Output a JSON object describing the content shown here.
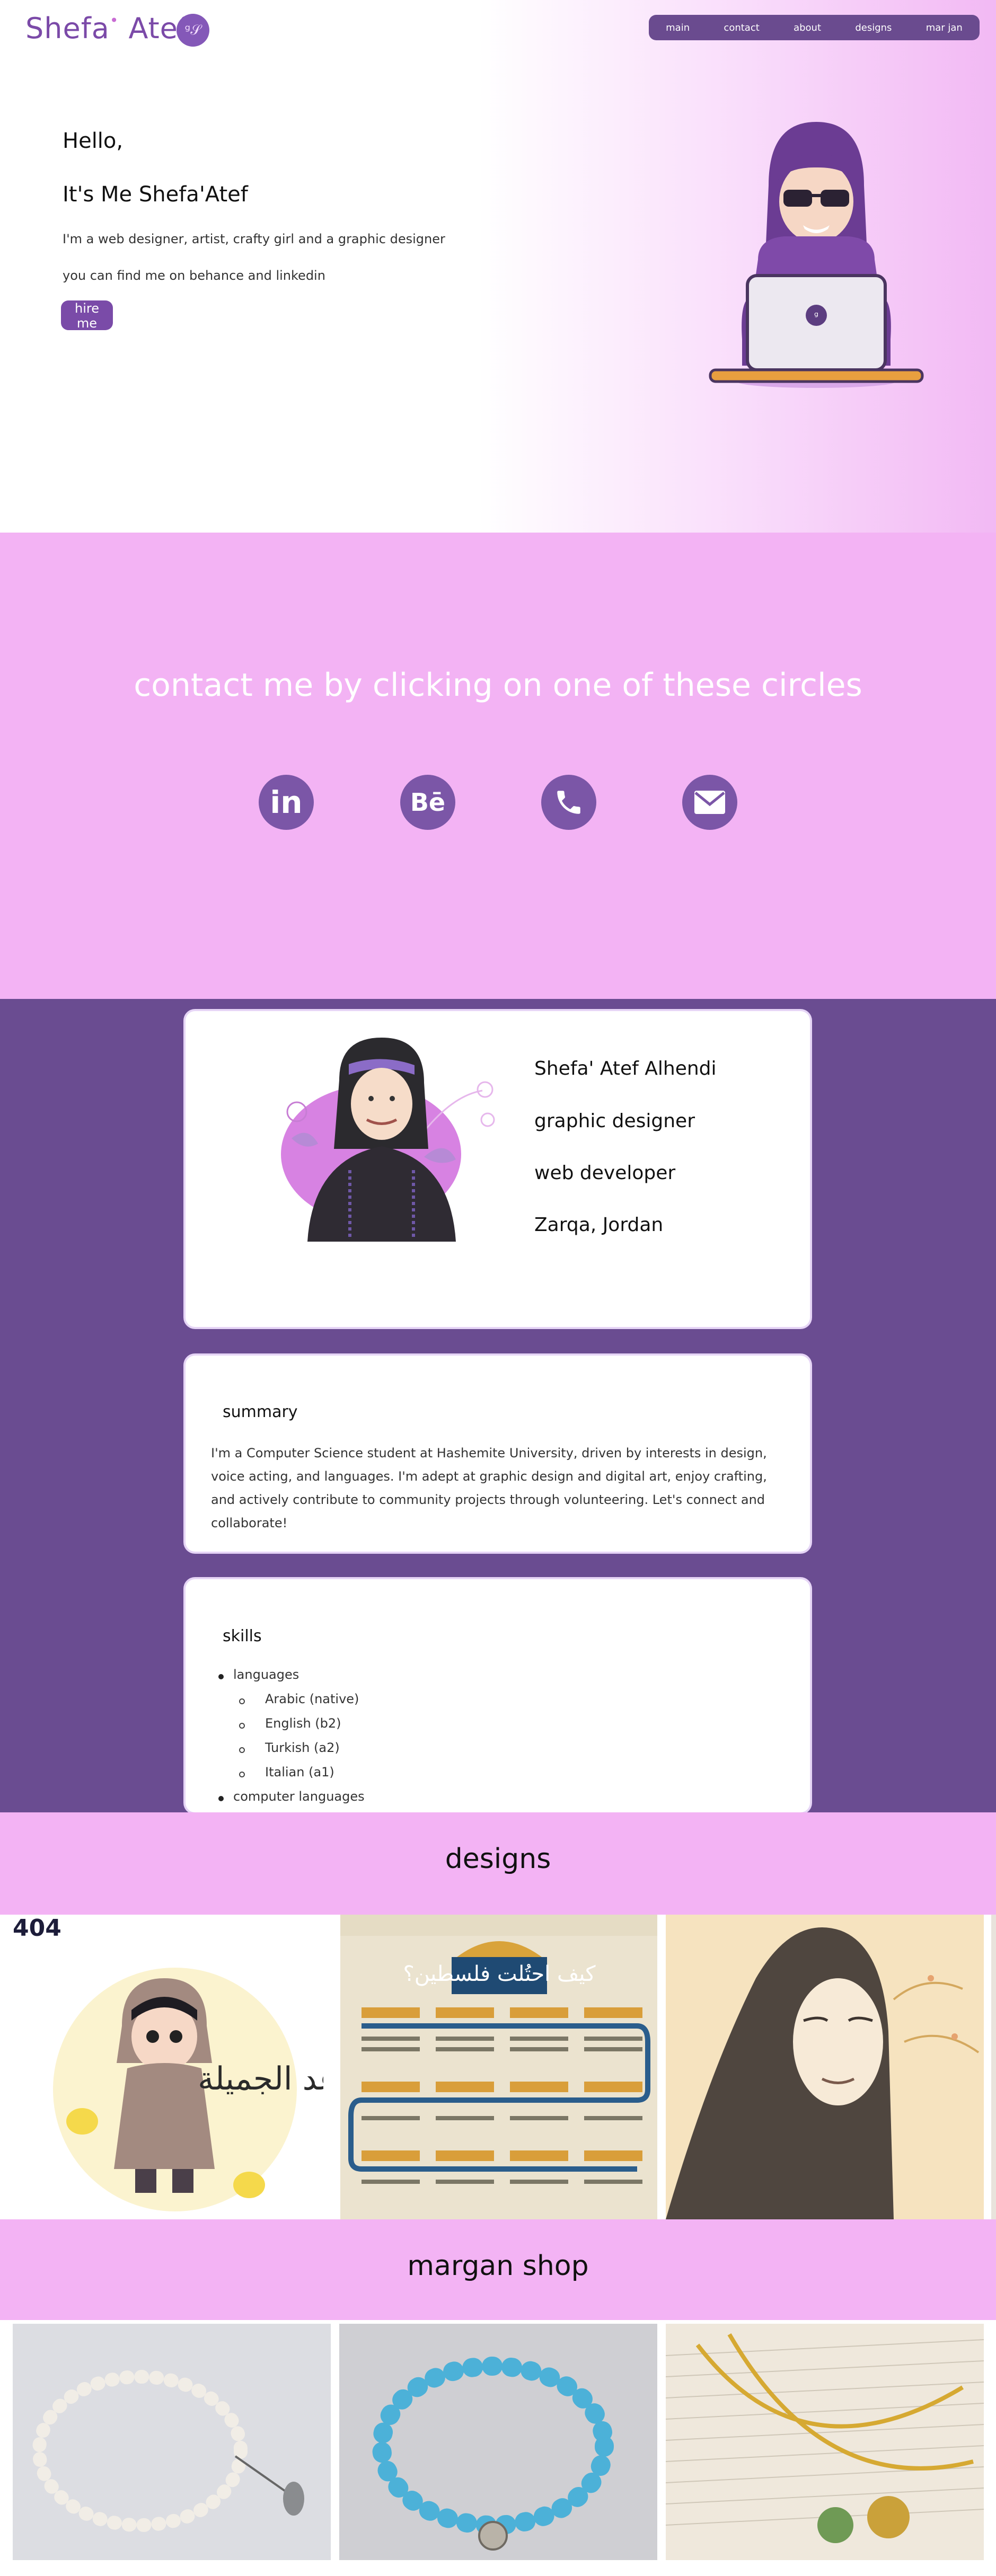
{
  "brand": {
    "logo_text": "Shefa",
    "logo_text2": " Atef",
    "badge": "ᵍ𝒮"
  },
  "nav": {
    "items": [
      "main",
      "contact",
      "about",
      "designs",
      "mar jan"
    ]
  },
  "hero": {
    "greeting": "Hello,",
    "name_line": "It's Me Shefa'Atef",
    "desc": "I'm a web designer, artist, crafty girl and a graphic designer",
    "find": "you can find me on behance and linkedin",
    "hire": "hire me"
  },
  "contact": {
    "title": "contact me by clicking on one of these circles",
    "icons": [
      "linkedin-icon",
      "behance-icon",
      "phone-icon",
      "email-icon"
    ],
    "linkedin_glyph": "in",
    "behance_glyph": "Bē"
  },
  "about": {
    "full_name": "Shefa' Atef Alhendi",
    "role1": "graphic designer",
    "role2": "web developer",
    "location": "Zarqa, Jordan",
    "summary_title": "summary",
    "summary_text": "I'm a Computer Science student at Hashemite University, driven by interests in design, voice acting, and languages. I'm adept at graphic design and digital art, enjoy crafting, and actively contribute to community projects through volunteering. Let's connect and collaborate!",
    "skills_title": "skills",
    "skills": {
      "languages_label": "languages",
      "languages": [
        "Arabic (native)",
        "English (b2)",
        "Turkish (a2)",
        "Italian (a1)"
      ],
      "computer_label": "computer languages"
    }
  },
  "designs": {
    "title": "designs",
    "card1_corner": "404",
    "card1_arabic": "وعد الجميلة",
    "card2_arabic_title": "كيف احتُلت فلسطين؟"
  },
  "shop": {
    "title": "margan shop"
  },
  "colors": {
    "purple": "#6a4c91",
    "pink": "#f3b3f4",
    "accent": "#7b4aa8"
  }
}
